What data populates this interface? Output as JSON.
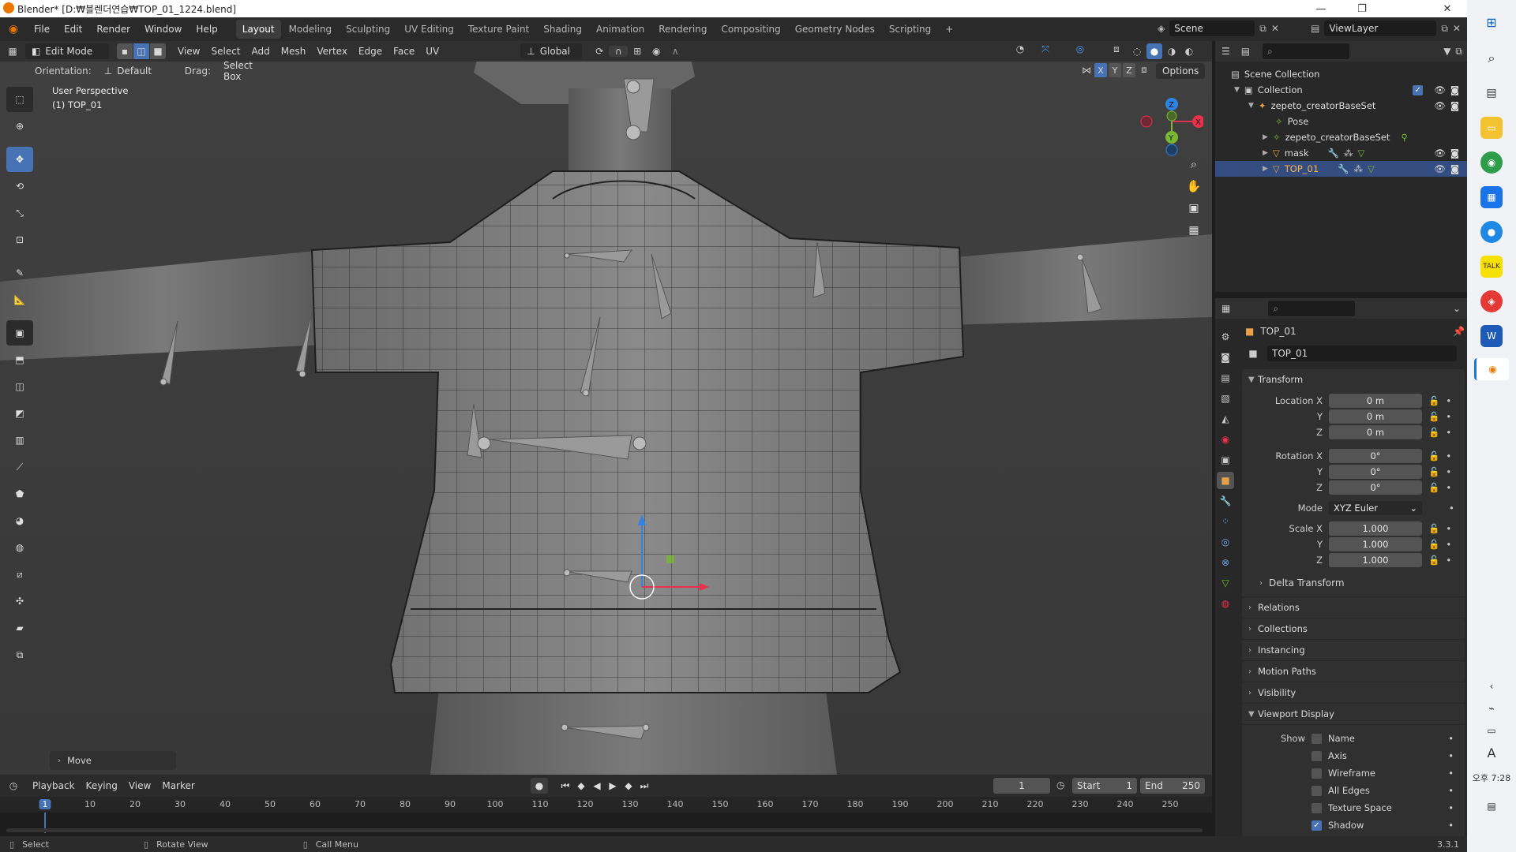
{
  "window": {
    "title": "Blender* [D:₩블렌더연습₩TOP_01_1224.blend]",
    "minimize": "—",
    "maximize": "❐",
    "close": "✕"
  },
  "menu": [
    "File",
    "Edit",
    "Render",
    "Window",
    "Help"
  ],
  "workspaces": [
    "Layout",
    "Modeling",
    "Sculpting",
    "UV Editing",
    "Texture Paint",
    "Shading",
    "Animation",
    "Rendering",
    "Compositing",
    "Geometry Nodes",
    "Scripting"
  ],
  "add_workspace": "+",
  "scene": {
    "name": "Scene",
    "view_layer": "ViewLayer"
  },
  "viewport_header": {
    "mode": "Edit Mode",
    "menus": [
      "View",
      "Select",
      "Add",
      "Mesh",
      "Vertex",
      "Edge",
      "Face",
      "UV"
    ],
    "transform_orientation": "Global",
    "orientation_label": "Orientation:",
    "orientation_value": "Default",
    "drag_label": "Drag:",
    "drag_value": "Select Box",
    "axes": [
      "X",
      "Y",
      "Z"
    ],
    "options": "Options"
  },
  "viewport": {
    "view_name": "User Perspective",
    "object_name": "(1) TOP_01",
    "last_operator": "Move",
    "gizmo_axes": {
      "x": "X",
      "y": "Y",
      "z": "Z"
    }
  },
  "outliner": {
    "search_placeholder": "",
    "items": [
      {
        "label": "Scene Collection"
      },
      {
        "label": "Collection"
      },
      {
        "label": "zepeto_creatorBaseSet"
      },
      {
        "label": "Pose"
      },
      {
        "label": "zepeto_creatorBaseSet"
      },
      {
        "label": "mask"
      },
      {
        "label": "TOP_01"
      }
    ]
  },
  "properties": {
    "object_name": "TOP_01",
    "datablock": "TOP_01",
    "transform_title": "Transform",
    "location": {
      "label_x": "Location X",
      "label_y": "Y",
      "label_z": "Z",
      "x": "0 m",
      "y": "0 m",
      "z": "0 m"
    },
    "rotation": {
      "label_x": "Rotation X",
      "label_y": "Y",
      "label_z": "Z",
      "x": "0°",
      "y": "0°",
      "z": "0°"
    },
    "mode_label": "Mode",
    "mode_value": "XYZ Euler",
    "scale": {
      "label_x": "Scale X",
      "label_y": "Y",
      "label_z": "Z",
      "x": "1.000",
      "y": "1.000",
      "z": "1.000"
    },
    "delta_transform": "Delta Transform",
    "panels": [
      "Relations",
      "Collections",
      "Instancing",
      "Motion Paths",
      "Visibility"
    ],
    "viewport_display": "Viewport Display",
    "show_label": "Show",
    "show_options": [
      {
        "label": "Name",
        "checked": false
      },
      {
        "label": "Axis",
        "checked": false
      },
      {
        "label": "Wireframe",
        "checked": false
      },
      {
        "label": "All Edges",
        "checked": false
      },
      {
        "label": "Texture Space",
        "checked": false
      },
      {
        "label": "Shadow",
        "checked": true
      }
    ]
  },
  "timeline": {
    "menus": [
      "Playback",
      "Keying",
      "View",
      "Marker"
    ],
    "current_frame": "1",
    "start_label": "Start",
    "start": "1",
    "end_label": "End",
    "end": "250",
    "ticks": [
      "1",
      "10",
      "20",
      "30",
      "40",
      "50",
      "60",
      "70",
      "80",
      "90",
      "100",
      "110",
      "120",
      "130",
      "140",
      "150",
      "160",
      "170",
      "180",
      "190",
      "200",
      "210",
      "220",
      "230",
      "240",
      "250"
    ]
  },
  "statusbar": {
    "select": "Select",
    "rotate": "Rotate View",
    "menu": "Call Menu",
    "version": "3.3.1"
  },
  "taskbar": {
    "time": "오후 7:28",
    "lang": "A"
  },
  "colors": {
    "accent": "#4772b3",
    "selected_row": "#334d80",
    "x_axis": "#e8314c",
    "y_axis": "#7ab832",
    "z_axis": "#2f83e3"
  }
}
